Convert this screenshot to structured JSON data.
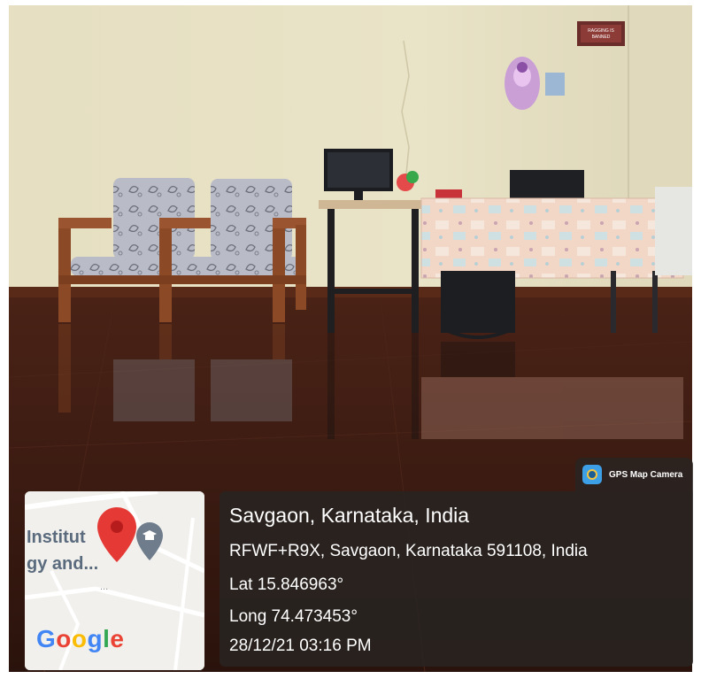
{
  "overlay": {
    "app_badge": {
      "label": "GPS Map Camera",
      "icon": "gps-map-camera-icon"
    },
    "location": {
      "title": "Savgaon, Karnataka, India",
      "address": "RFWF+R9X, Savgaon, Karnataka 591108, India",
      "latitude": "Lat 15.846963°",
      "longitude": "Long 74.473453°",
      "datetime": "28/12/21 03:16 PM"
    },
    "map": {
      "label_line1": "Institut",
      "label_line2": "gy and...",
      "dots": "...",
      "pin_icon": "map-pin-icon",
      "poi_icon": "education-poi-icon",
      "logo": [
        "G",
        "o",
        "o",
        "g",
        "l",
        "e"
      ],
      "logo_colors": [
        "#4285F4",
        "#EA4335",
        "#FBBC05",
        "#4285F4",
        "#34A853",
        "#EA4335"
      ]
    }
  },
  "photo": {
    "wall_sign": "RAGGING IS BANNED",
    "colors": {
      "wall": "#e4ddbf",
      "floor": "#3a1b12",
      "wood": "#8b4a25",
      "cloth": "#f0d2c4"
    }
  }
}
